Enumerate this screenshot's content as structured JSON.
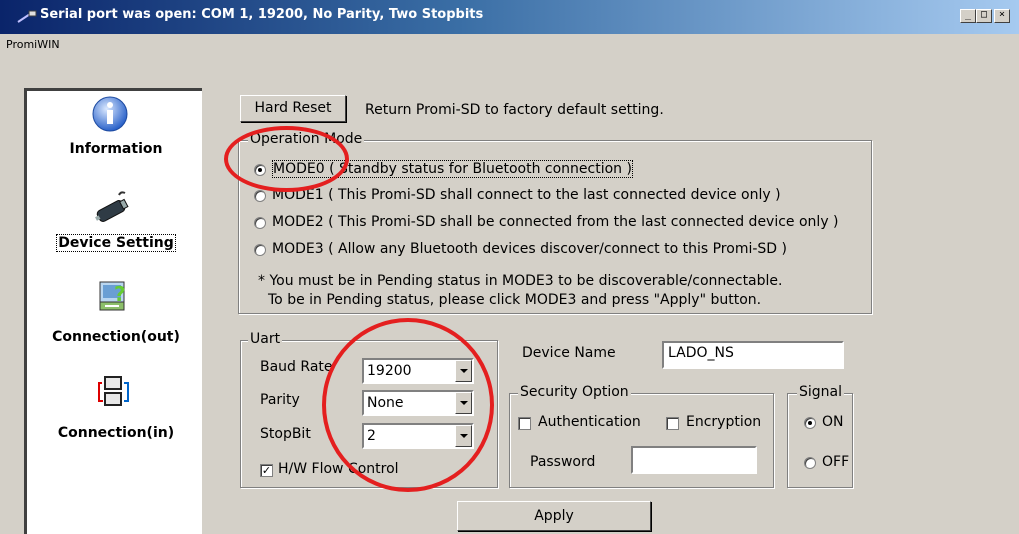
{
  "window": {
    "title": "Serial port was open: COM 1, 19200, No Parity, Two Stopbits",
    "menu": [
      "PromiWIN"
    ],
    "caption_buttons": [
      "minimize",
      "maximize",
      "close"
    ]
  },
  "sidebar": {
    "items": [
      {
        "label": "Information",
        "icon": "info-icon",
        "selected": false
      },
      {
        "label": "Device Setting",
        "icon": "serial-device-icon",
        "selected": true
      },
      {
        "label": "Connection(out)",
        "icon": "connection-out-icon",
        "selected": false
      },
      {
        "label": "Connection(in)",
        "icon": "connection-in-icon",
        "selected": false
      }
    ]
  },
  "hard_reset": {
    "button_label": "Hard Reset",
    "description": "Return Promi-SD to factory default setting."
  },
  "operation_mode": {
    "legend": "Operation Mode",
    "options": [
      {
        "label": "MODE0 ( Standby status for Bluetooth connection )",
        "selected": true
      },
      {
        "label": "MODE1 ( This Promi-SD shall connect to the last connected device only )",
        "selected": false
      },
      {
        "label": "MODE2 ( This Promi-SD shall be connected from the last connected device only )",
        "selected": false
      },
      {
        "label": "MODE3 ( Allow any Bluetooth devices discover/connect to this Promi-SD )",
        "selected": false
      }
    ],
    "note_line1": "* You must be in Pending status in MODE3 to be discoverable/connectable.",
    "note_line2": "To be in Pending status, please click MODE3 and press \"Apply\" button."
  },
  "uart": {
    "legend": "Uart",
    "baud_rate_label": "Baud Rate",
    "baud_rate_value": "19200",
    "parity_label": "Parity",
    "parity_value": "None",
    "stopbit_label": "StopBit",
    "stopbit_value": "2",
    "flow_control_label": "H/W Flow Control",
    "flow_control_checked": true
  },
  "device": {
    "name_label": "Device Name",
    "name_value": "LADO_NS"
  },
  "security": {
    "legend": "Security Option",
    "authentication_label": "Authentication",
    "authentication_checked": false,
    "encryption_label": "Encryption",
    "encryption_checked": false,
    "password_label": "Password",
    "password_value": ""
  },
  "signal": {
    "legend": "Signal",
    "on_label": "ON",
    "off_label": "OFF",
    "selected": "ON"
  },
  "apply_label": "Apply",
  "colors": {
    "face": "#d4d0c8",
    "title_start": "#0a246a",
    "title_end": "#a6caf0",
    "annotation_ring": "#e41f1f"
  }
}
